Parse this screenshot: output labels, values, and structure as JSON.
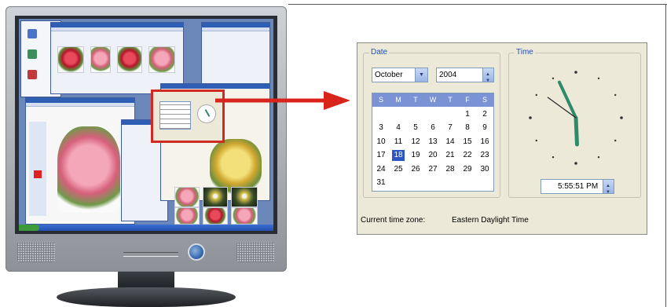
{
  "date_group": {
    "label": "Date",
    "month": "October",
    "year": "2004",
    "weekday_headers": [
      "S",
      "M",
      "T",
      "W",
      "T",
      "F",
      "S"
    ],
    "days": [
      "",
      "",
      "",
      "",
      "",
      "1",
      "2",
      "3",
      "4",
      "5",
      "6",
      "7",
      "8",
      "9",
      "10",
      "11",
      "12",
      "13",
      "14",
      "15",
      "16",
      "17",
      "18",
      "19",
      "20",
      "21",
      "22",
      "23",
      "24",
      "25",
      "26",
      "27",
      "28",
      "29",
      "30",
      "31",
      "",
      "",
      "",
      "",
      "",
      ""
    ],
    "selected_day": "18"
  },
  "time_group": {
    "label": "Time",
    "time_value": "5:55:51 PM",
    "clock": {
      "hour": 5,
      "minute": 55,
      "second": 51
    }
  },
  "timezone": {
    "label": "Current time zone:",
    "name": "Eastern Daylight Time"
  },
  "colors": {
    "arrow": "#d9231b",
    "highlight_box": "#d12a22",
    "calendar_header": "#7b93d4",
    "selected_day": "#2c56c4",
    "clock_hands": "#2f8a6a"
  },
  "icons": {
    "month_dropdown": "chevron-down-icon",
    "year_spinner": "spinner-icon",
    "time_spinner": "spinner-icon",
    "callout_arrow": "arrow-right-icon"
  }
}
